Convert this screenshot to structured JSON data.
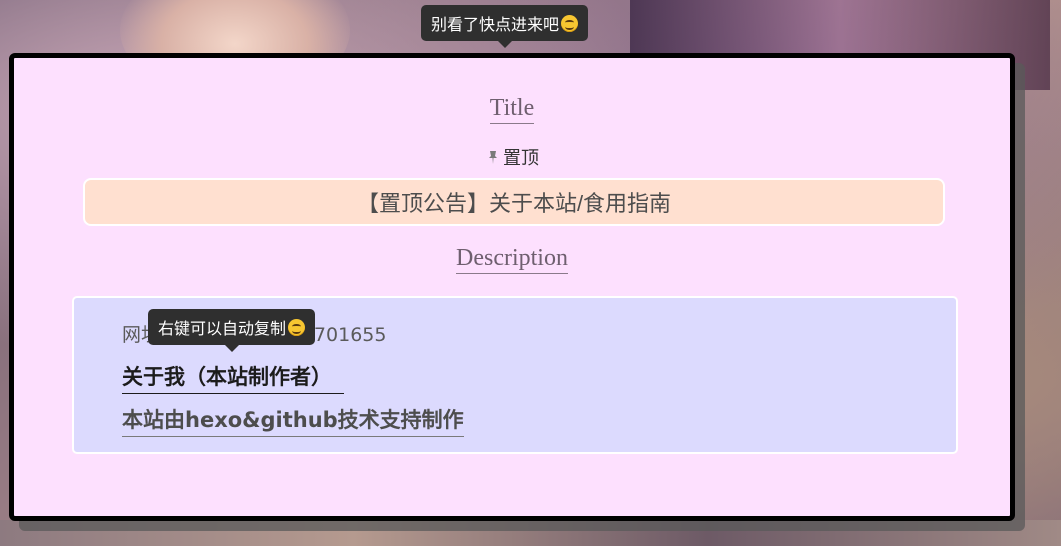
{
  "tooltips": {
    "top": "别看了快点进来吧",
    "copy": "右键可以自动复制"
  },
  "icons": {
    "emoji": "smiling-face-icon",
    "pin": "pin-icon"
  },
  "modal": {
    "title_heading": "Title",
    "pinned_label": "置顶",
    "notice_text": "【置顶公告】关于本站/食用指南",
    "description_heading": "Description",
    "site_line": "网址：xxxxxxxxxxxx701655",
    "about_link": "关于我（本站制作者）",
    "powered_by": "本站由hexo&github技术支持制作"
  },
  "colors": {
    "modal_bg": "#fde0fe",
    "notice_bg": "#ffe0d0",
    "description_bg": "#dcdafe",
    "tooltip_bg": "#2f2f2f"
  }
}
